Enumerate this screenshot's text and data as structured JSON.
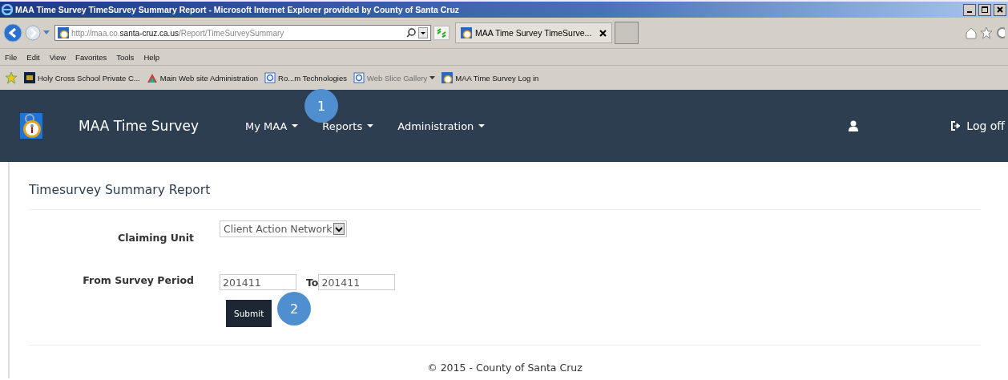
{
  "window": {
    "title": "MAA Time Survey TimeSurvey Summary Report - Microsoft Internet Explorer provided by County of Santa Cruz"
  },
  "address_bar": {
    "url_prefix": "http://maa.co.",
    "url_domain": "santa-cruz.ca.us",
    "url_path": "/Report/TimeSurveySummary"
  },
  "tabs": [
    {
      "label": "MAA Time Survey TimeSurve...",
      "selected": true
    }
  ],
  "menu_bar": [
    "File",
    "Edit",
    "View",
    "Favorites",
    "Tools",
    "Help"
  ],
  "favorites_bar": [
    {
      "label": "Holy Cross School  Private C...",
      "kind": "hc"
    },
    {
      "label": "Main Web site Administration",
      "kind": "people"
    },
    {
      "label": "Ro...m Technologies",
      "kind": "ie"
    },
    {
      "label": "Web Slice Gallery",
      "kind": "slice"
    },
    {
      "label": "MAA Time Survey Log in",
      "kind": "app"
    }
  ],
  "navbar": {
    "brand": "MAA Time Survey",
    "menus": [
      "My MAA",
      "Reports",
      "Administration"
    ],
    "logoff": "Log off"
  },
  "page": {
    "heading": "Timesurvey Summary Report",
    "form": {
      "claiming_unit_label": "Claiming Unit",
      "claiming_unit_value": "Client Action Network",
      "period_label": "From Survey Period",
      "period_from": "201411",
      "to_label": "To",
      "period_to": "201411",
      "submit": "Submit"
    },
    "footer": "© 2015 - County of Santa Cruz"
  },
  "annotations": [
    {
      "label": "1"
    },
    {
      "label": "2"
    }
  ]
}
